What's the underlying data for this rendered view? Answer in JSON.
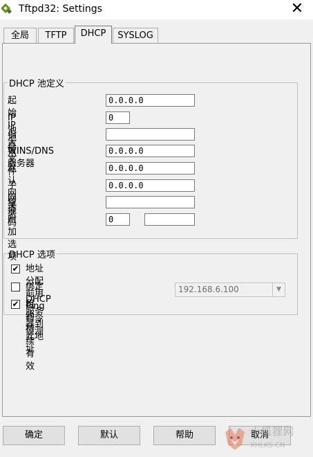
{
  "window": {
    "title": "Tftpd32: Settings",
    "close_symbol": "✕"
  },
  "tabs": [
    {
      "label": "全局",
      "selected": false
    },
    {
      "label": "TFTP",
      "selected": false
    },
    {
      "label": "DHCP",
      "selected": true
    },
    {
      "label": "SYSLOG",
      "selected": false
    }
  ],
  "dhcp_pool": {
    "legend": "DHCP 池定义",
    "fields": [
      {
        "label": "起始 IP 地址",
        "value": "0.0.0.0"
      },
      {
        "label": "IP 池大小",
        "value": "0"
      },
      {
        "label": "引导文件",
        "value": ""
      },
      {
        "label": "WINS/DNS 服务器",
        "value": "0.0.0.0"
      },
      {
        "label": "默认网关",
        "value": "0.0.0.0"
      },
      {
        "label": "子网掩码",
        "value": "0.0.0.0"
      },
      {
        "label": "域名",
        "value": ""
      },
      {
        "label": "附加选项",
        "value": "0",
        "value2": ""
      }
    ]
  },
  "dhcp_options": {
    "legend": "DHCP 选项",
    "options": [
      {
        "label": "地址分配前用 Ping 命令侦测",
        "checked": true
      },
      {
        "label": "绑定 DHCP 服务器到此地址",
        "checked": false
      },
      {
        "label": "租约持续有效",
        "checked": true
      }
    ],
    "bind_address": "192.168.6.100",
    "check_mark": "✔"
  },
  "buttons": {
    "ok": "确定",
    "default": "默认",
    "help": "帮助",
    "cancel": "取消"
  },
  "watermark": {
    "text_zh": "小狐狸网",
    "text_en": "XHLKS.CN"
  }
}
